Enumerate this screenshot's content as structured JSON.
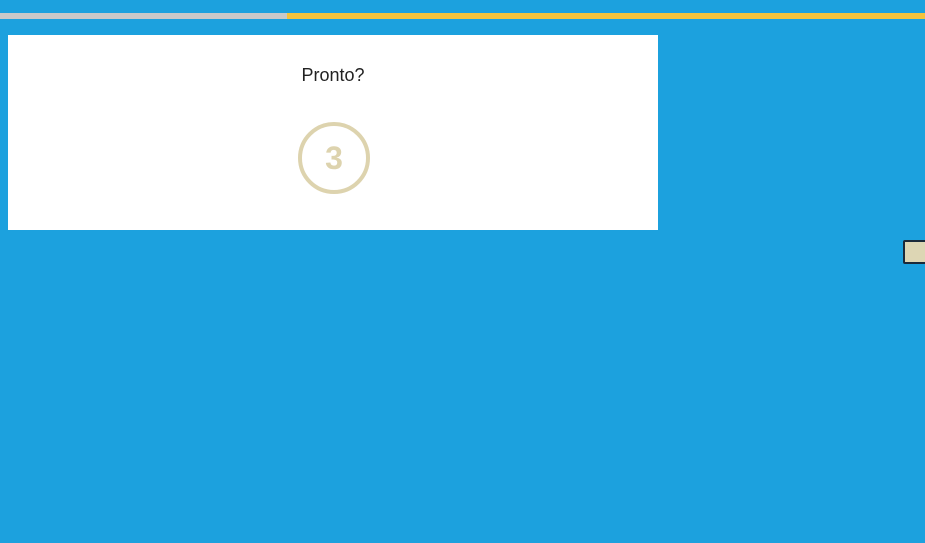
{
  "progress": {
    "fraction": 0.31,
    "fill_color": "#c9c9c9",
    "track_color": "#f5c33b"
  },
  "countdown": {
    "prompt": "Pronto?",
    "number": "3",
    "circle_color": "#ddd3ae"
  },
  "background_color": "#1ca1de",
  "tile_color": "#ddd6b4"
}
